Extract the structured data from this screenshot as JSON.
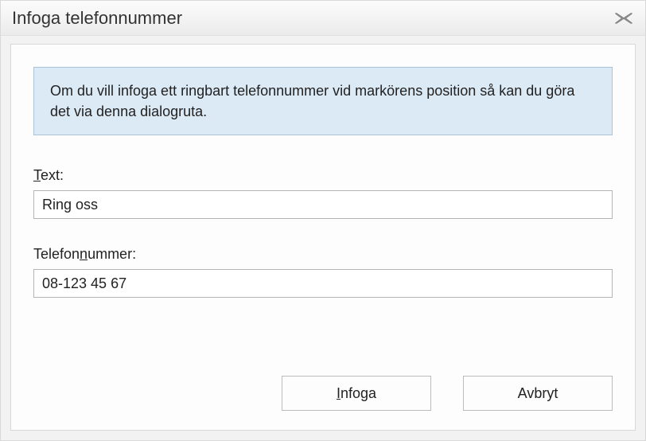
{
  "title": "Infoga telefonnummer",
  "info_text": "Om du vill infoga ett ringbart telefonnummer vid markörens position så kan du göra det via denna dialogruta.",
  "fields": {
    "text": {
      "label_pre": "",
      "label_mnem": "T",
      "label_post": "ext:",
      "value": "Ring oss"
    },
    "phone": {
      "label_pre": "Telefon",
      "label_mnem": "n",
      "label_post": "ummer:",
      "value": "08-123 45 67"
    }
  },
  "buttons": {
    "insert": {
      "pre": "",
      "mnem": "I",
      "post": "nfoga"
    },
    "cancel": {
      "text": "Avbryt"
    }
  }
}
